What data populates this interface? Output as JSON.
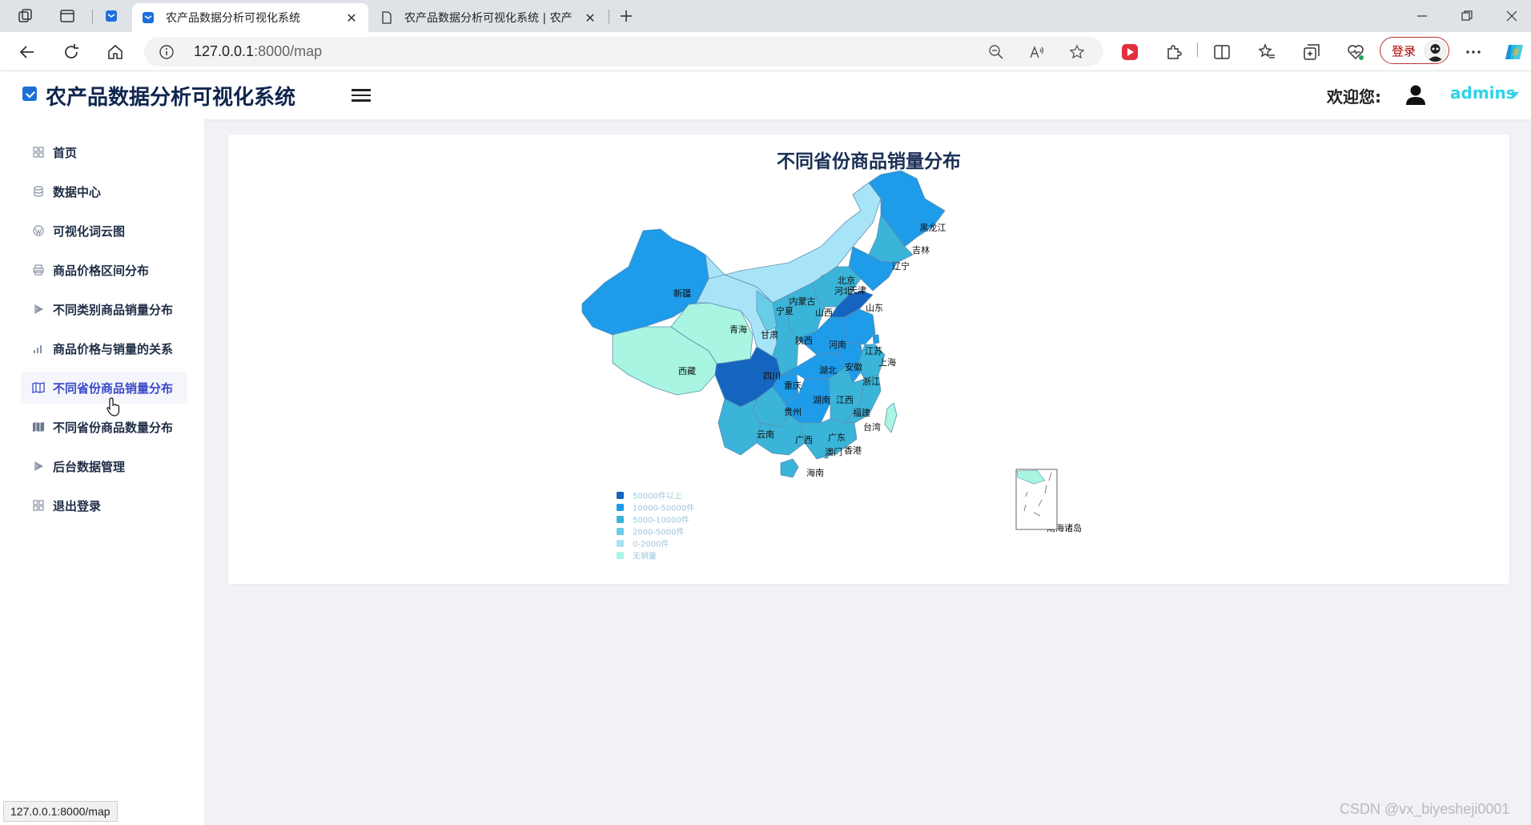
{
  "browser": {
    "tabs": [
      {
        "title": "农产品数据分析可视化系统",
        "active": true
      },
      {
        "title": "农产品数据分析可视化系统 | 农产",
        "active": false
      }
    ],
    "url_host": "127.0.0.1",
    "url_path": ":8000/map",
    "login_label": "登录"
  },
  "header": {
    "brand": "农产品数据分析可视化系统",
    "welcome": "欢迎您:",
    "username": "admins"
  },
  "sidebar": {
    "items": [
      {
        "label": "首页",
        "icon": "grid-icon"
      },
      {
        "label": "数据中心",
        "icon": "database-icon"
      },
      {
        "label": "可视化词云图",
        "icon": "wordpress-icon"
      },
      {
        "label": "商品价格区间分布",
        "icon": "printer-icon"
      },
      {
        "label": "不同类别商品销量分布",
        "icon": "play-icon"
      },
      {
        "label": "商品价格与销量的关系",
        "icon": "bar-chart-icon"
      },
      {
        "label": "不同省份商品销量分布",
        "icon": "map-icon",
        "active": true
      },
      {
        "label": "不同省份商品数量分布",
        "icon": "map-filled-icon"
      },
      {
        "label": "后台数据管理",
        "icon": "play-icon"
      },
      {
        "label": "退出登录",
        "icon": "grid-icon"
      }
    ]
  },
  "chart_data": {
    "type": "map",
    "title": "不同省份商品销量分布",
    "legend": [
      {
        "label": "50000件以上",
        "color": "#1565c0"
      },
      {
        "label": "10000-50000件",
        "color": "#1e9be9"
      },
      {
        "label": "5000-10000件",
        "color": "#3ab4d9"
      },
      {
        "label": "2000-5000件",
        "color": "#69cde8"
      },
      {
        "label": "0-2000件",
        "color": "#a8e4f8"
      },
      {
        "label": "无销量",
        "color": "#a8f5e2"
      }
    ],
    "regions": [
      {
        "name": "黑龙江",
        "level": "10000-50000件"
      },
      {
        "name": "吉林",
        "level": "5000-10000件"
      },
      {
        "name": "辽宁",
        "level": "10000-50000件"
      },
      {
        "name": "内蒙古",
        "level": "0-2000件"
      },
      {
        "name": "北京",
        "level": "5000-10000件"
      },
      {
        "name": "天津",
        "level": "2000-5000件"
      },
      {
        "name": "河北",
        "level": "5000-10000件"
      },
      {
        "name": "山西",
        "level": "5000-10000件"
      },
      {
        "name": "山东",
        "level": "50000件以上"
      },
      {
        "name": "河南",
        "level": "10000-50000件"
      },
      {
        "name": "陕西",
        "level": "5000-10000件"
      },
      {
        "name": "宁夏",
        "level": "2000-5000件"
      },
      {
        "name": "甘肃",
        "level": "0-2000件"
      },
      {
        "name": "新疆",
        "level": "10000-50000件"
      },
      {
        "name": "青海",
        "level": "无销量"
      },
      {
        "name": "西藏",
        "level": "无销量"
      },
      {
        "name": "四川",
        "level": "50000件以上"
      },
      {
        "name": "重庆",
        "level": "10000-50000件"
      },
      {
        "name": "湖北",
        "level": "10000-50000件"
      },
      {
        "name": "安徽",
        "level": "10000-50000件"
      },
      {
        "name": "江苏",
        "level": "10000-50000件"
      },
      {
        "name": "上海",
        "level": "10000-50000件"
      },
      {
        "name": "浙江",
        "level": "5000-10000件"
      },
      {
        "name": "湖南",
        "level": "10000-50000件"
      },
      {
        "name": "江西",
        "level": "5000-10000件"
      },
      {
        "name": "福建",
        "level": "5000-10000件"
      },
      {
        "name": "贵州",
        "level": "5000-10000件"
      },
      {
        "name": "云南",
        "level": "5000-10000件"
      },
      {
        "name": "广西",
        "level": "5000-10000件"
      },
      {
        "name": "广东",
        "level": "5000-10000件"
      },
      {
        "name": "澳门",
        "level": "5000-10000件"
      },
      {
        "name": "香港",
        "level": "5000-10000件"
      },
      {
        "name": "海南",
        "level": "5000-10000件"
      },
      {
        "name": "台湾",
        "level": "无销量"
      },
      {
        "name": "南海诸岛",
        "level": "无销量"
      }
    ]
  },
  "status_bar_url": "127.0.0.1:8000/map",
  "watermark": "CSDN @vx_biyesheji0001"
}
